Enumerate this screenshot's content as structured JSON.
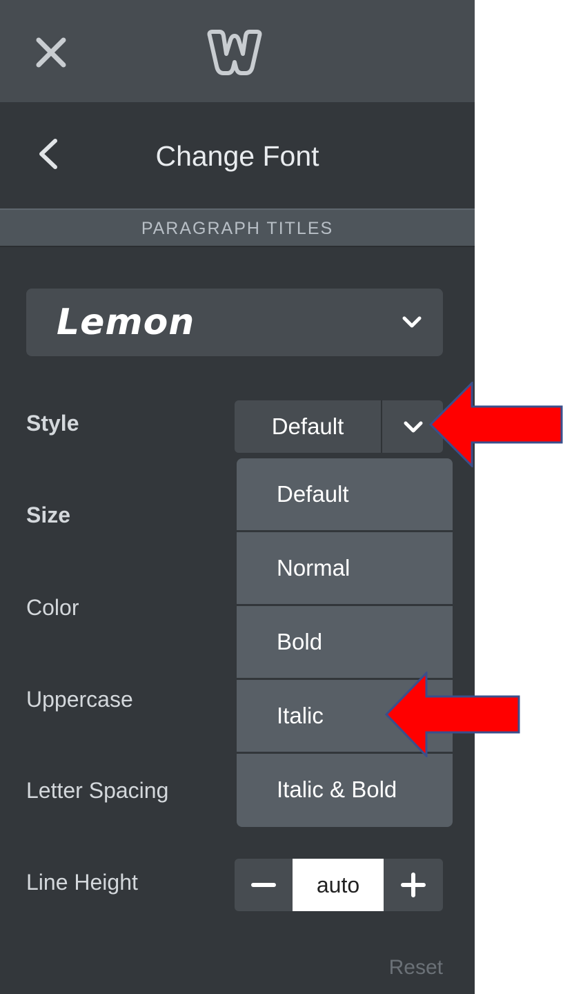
{
  "top_bar": {
    "close_icon": "close-icon",
    "logo_icon": "weebly-logo-icon"
  },
  "header": {
    "back_icon": "chevron-left-icon",
    "title": "Change Font"
  },
  "section": {
    "label": "PARAGRAPH TITLES"
  },
  "font_selector": {
    "value": "Lemon",
    "icon": "chevron-down-icon"
  },
  "labels": {
    "style": "Style",
    "size": "Size",
    "color": "Color",
    "uppercase": "Uppercase",
    "letter_spacing": "Letter Spacing",
    "line_height": "Line Height"
  },
  "style_control": {
    "value": "Default",
    "icon": "chevron-down-icon"
  },
  "style_dropdown": {
    "options": [
      "Default",
      "Normal",
      "Bold",
      "Italic",
      "Italic & Bold"
    ]
  },
  "line_height": {
    "minus_label": "−",
    "value": "auto",
    "plus_label": "+"
  },
  "reset_label": "Reset",
  "annotations": {
    "arrow_color": "#ff0000",
    "arrow_outline": "#3a4f8c"
  },
  "colors": {
    "panel_bg": "#33373b",
    "topbar_bg": "#474c51",
    "dropdown_bg": "#585f66",
    "page_bg": "#ffffff"
  }
}
